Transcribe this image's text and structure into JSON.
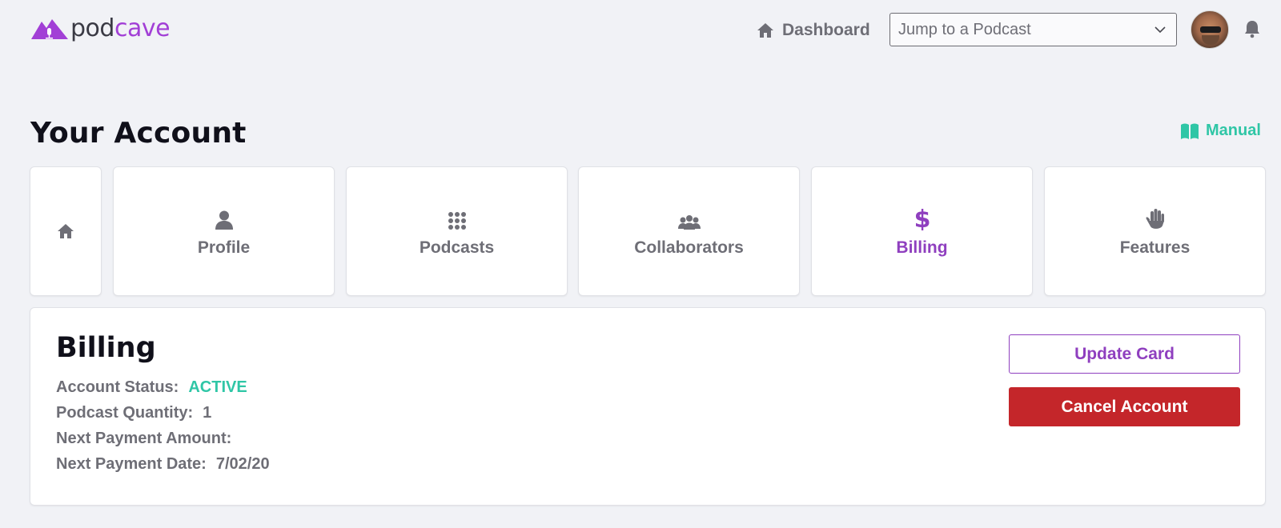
{
  "header": {
    "logo": {
      "part1": "pod",
      "part2": "cave",
      "icon": "mountain-mic-logo"
    },
    "dashboard_label": "Dashboard",
    "jump_select": {
      "value": "Jump to a Podcast",
      "icon": "chevron-down-icon"
    },
    "icons": [
      "home-icon",
      "avatar",
      "bell-icon"
    ]
  },
  "page": {
    "title": "Your Account",
    "manual_label": "Manual"
  },
  "tabs": [
    {
      "label": "",
      "icon": "home-icon"
    },
    {
      "label": "Profile",
      "icon": "user-icon"
    },
    {
      "label": "Podcasts",
      "icon": "grid-dots-icon"
    },
    {
      "label": "Collaborators",
      "icon": "users-icon"
    },
    {
      "label": "Billing",
      "icon": "dollar-icon",
      "active": true
    },
    {
      "label": "Features",
      "icon": "hand-icon"
    }
  ],
  "billing": {
    "title": "Billing",
    "account_status_label": "Account Status:",
    "account_status_value": "ACTIVE",
    "podcast_quantity_label": "Podcast Quantity:",
    "podcast_quantity_value": "1",
    "next_payment_amount_label": "Next Payment Amount:",
    "next_payment_amount_value": "",
    "next_payment_date_label": "Next Payment Date:",
    "next_payment_date_value": "7/02/20",
    "update_card_label": "Update Card",
    "cancel_account_label": "Cancel Account"
  },
  "colors": {
    "accent_purple": "#8f3fbf",
    "logo_purple": "#a23fd6",
    "teal": "#2fc6a6",
    "danger_red": "#c4262a",
    "background": "#f1f2f6"
  }
}
